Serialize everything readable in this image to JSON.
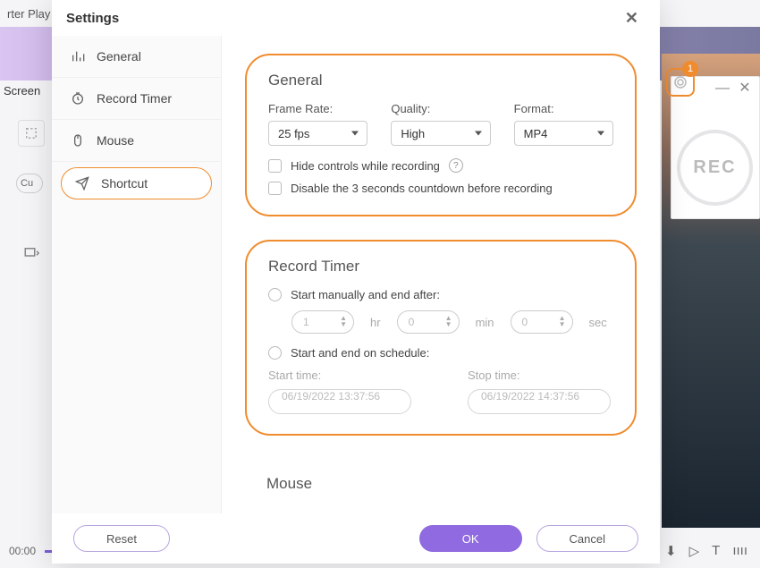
{
  "bg": {
    "app_title_partial": "rter Play",
    "screen_label": "Screen",
    "cut_label": "Cu",
    "rec_label": "REC",
    "badge_value": "1",
    "timeline_time": "00:00",
    "bottom_icons": [
      "pause",
      "trim",
      "T",
      "wave"
    ]
  },
  "modal": {
    "title": "Settings",
    "close": "✕"
  },
  "sidebar": {
    "items": [
      {
        "label": "General",
        "icon": "chart-icon"
      },
      {
        "label": "Record Timer",
        "icon": "clock-icon"
      },
      {
        "label": "Mouse",
        "icon": "mouse-icon"
      },
      {
        "label": "Shortcut",
        "icon": "paper-plane-icon"
      }
    ]
  },
  "general": {
    "title": "General",
    "frame_rate_label": "Frame Rate:",
    "frame_rate_value": "25 fps",
    "quality_label": "Quality:",
    "quality_value": "High",
    "format_label": "Format:",
    "format_value": "MP4",
    "hide_controls_label": "Hide controls while recording",
    "disable_countdown_label": "Disable the 3 seconds countdown before recording"
  },
  "record_timer": {
    "title": "Record Timer",
    "manual_label": "Start manually and end after:",
    "hr_label": "hr",
    "min_label": "min",
    "sec_label": "sec",
    "hr_value": "1",
    "min_value": "0",
    "sec_value": "0",
    "schedule_label": "Start and end on schedule:",
    "start_time_label": "Start time:",
    "stop_time_label": "Stop time:",
    "start_time_value": "06/19/2022 13:37:56",
    "stop_time_value": "06/19/2022 14:37:56"
  },
  "mouse": {
    "title": "Mouse"
  },
  "footer": {
    "reset": "Reset",
    "ok": "OK",
    "cancel": "Cancel"
  }
}
